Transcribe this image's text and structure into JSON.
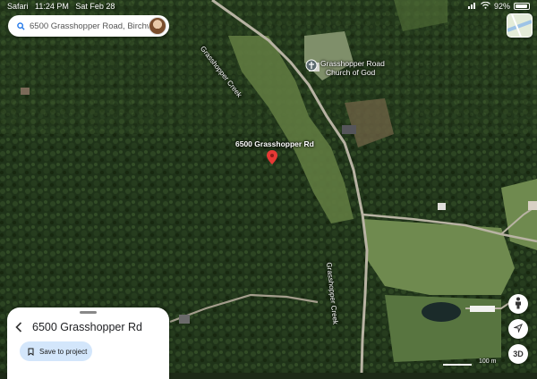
{
  "status_bar": {
    "app": "Safari",
    "time": "11:24 PM",
    "date": "Sat Feb 28",
    "battery": "92%",
    "battery_level": 0.92
  },
  "search": {
    "query": "6500 Grasshopper Road, Birchwo",
    "icon": "search-icon"
  },
  "map": {
    "view": "satellite",
    "pin_label": "6500 Grasshopper Rd",
    "poi": {
      "name_line1": "Grasshopper Road",
      "name_line2": "Church of God",
      "icon": "cross-icon"
    },
    "road_labels": {
      "creek_upper": "Grasshopper Creek",
      "creek_lower": "Grasshopper Creek"
    },
    "scale": "100 m"
  },
  "sheet": {
    "title": "6500 Grasshopper Rd",
    "save_label": "Save to project",
    "back_icon": "chevron-left-icon",
    "save_icon": "bookmark-icon"
  },
  "controls": {
    "pegman_icon": "pegman-icon",
    "locate_icon": "location-arrow-icon",
    "view_3d_label": "3D"
  },
  "colors": {
    "forest": "#1f3319",
    "field": "#6f8a4f",
    "pin": "#e53935",
    "save_button": "#d3e6fb"
  }
}
